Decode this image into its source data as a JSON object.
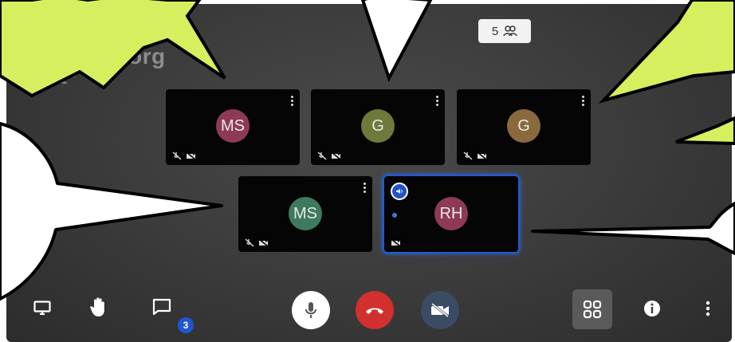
{
  "logo": {
    "text": "jitsi.org"
  },
  "participants_count": {
    "value": "5"
  },
  "tiles": [
    {
      "initials": "MS",
      "color": "#8e3a57"
    },
    {
      "initials": "G",
      "color": "#6d7a3a"
    },
    {
      "initials": "G",
      "color": "#8a6a3d"
    },
    {
      "initials": "MS",
      "color": "#3d7a5e"
    },
    {
      "initials": "RH",
      "color": "#8e3a57"
    }
  ],
  "toolbar": {
    "chat_badge": "3"
  },
  "colors": {
    "end_call": "#d22f2f",
    "active_speaker_border": "#1f5bd3",
    "callout_fill": "#d5ef5f"
  }
}
